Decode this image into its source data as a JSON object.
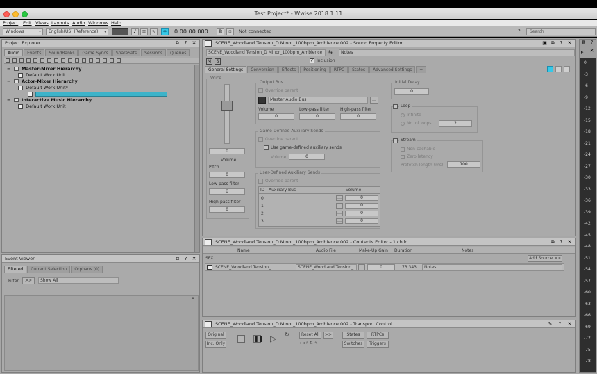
{
  "window": {
    "title": "Test Project* - Wwise 2018.1.11"
  },
  "menu": [
    "Project",
    "Edit",
    "Views",
    "Layouts",
    "Audio",
    "Windows",
    "Help"
  ],
  "toolbar": {
    "layout_value": "Windows",
    "language_value": "English(US) (Reference)",
    "timecode": "0:00:00.000",
    "connection_status": "Not connected",
    "help_glyph": "?",
    "search_placeholder": "Search"
  },
  "project_explorer": {
    "title": "Project Explorer",
    "tabs": [
      "Audio",
      "Events",
      "SoundBanks",
      "Game Syncs",
      "ShareSets",
      "Sessions",
      "Queries"
    ],
    "tree": [
      {
        "label": "Master-Mixer Hierarchy",
        "bold": true,
        "indent": 0
      },
      {
        "label": "Default Work Unit",
        "bold": false,
        "indent": 1
      },
      {
        "label": "Actor-Mixer Hierarchy",
        "bold": true,
        "indent": 0
      },
      {
        "label": "Default Work Unit*",
        "bold": false,
        "indent": 1
      },
      {
        "label": "Interactive Music Hierarchy",
        "bold": true,
        "indent": 0
      },
      {
        "label": "Default Work Unit",
        "bold": false,
        "indent": 1
      }
    ]
  },
  "event_viewer": {
    "title": "Event Viewer",
    "tabs": [
      "Filtered",
      "Current Selection",
      "Orphans (0)"
    ],
    "filter_label": "Filter",
    "filter_value": "Show All"
  },
  "sound_editor": {
    "title": "SCENE_Woodland Tension_D Minor_100bpm_Ambience 002 - Sound Property Editor",
    "object_name": "SCENE_Woodland Tension_D Minor_100bpm_Ambience",
    "notes_label": "Notes",
    "inclusion_label": "Inclusion",
    "tabs": [
      "General Settings",
      "Conversion",
      "Effects",
      "Positioning",
      "RTPC",
      "States",
      "Advanced Settings",
      "+"
    ],
    "voice": {
      "group": "Voice",
      "volume_value": "0",
      "volume_label": "Volume",
      "pitch_label": "Pitch",
      "pitch_value": "0",
      "lpf_label": "Low-pass filter",
      "lpf_value": "0",
      "hpf_label": "High-pass filter",
      "hpf_value": "0"
    },
    "output_bus": {
      "group": "Output Bus",
      "override_parent": "Override parent",
      "bus_name": "Master Audio Bus",
      "volume_label": "Volume",
      "volume_value": "0",
      "lpf_label": "Low-pass filter",
      "lpf_value": "0",
      "hpf_label": "High-pass filter",
      "hpf_value": "0"
    },
    "game_defined": {
      "group": "Game-Defined Auxiliary Sends",
      "override_parent": "Override parent",
      "use_label": "Use game-defined auxiliary sends",
      "volume_label": "Volume",
      "volume_value": "0"
    },
    "user_defined": {
      "group": "User-Defined Auxiliary Sends",
      "override_parent": "Override parent",
      "col_id": "ID",
      "col_bus": "Auxiliary Bus",
      "col_volume": "Volume",
      "rows": [
        {
          "id": "0",
          "value": "0"
        },
        {
          "id": "1",
          "value": "0"
        },
        {
          "id": "2",
          "value": "0"
        },
        {
          "id": "3",
          "value": "0"
        }
      ]
    },
    "initial_delay": {
      "group": "Initial Delay",
      "value": "0"
    },
    "loop": {
      "label": "Loop",
      "infinite": "Infinite",
      "no_of_loops": "No. of loops",
      "count": "2"
    },
    "stream": {
      "label": "Stream",
      "non_cachable": "Non-cachable",
      "zero_latency": "Zero latency",
      "prefetch_label": "Prefetch length (ms):",
      "prefetch_value": "100"
    }
  },
  "contents_editor": {
    "title": "SCENE_Woodland Tension_D Minor_100bpm_Ambience 002 - Contents Editor - 1 child",
    "columns": [
      "Name",
      "Audio File",
      "Make-Up Gain",
      "Duration",
      "Notes"
    ],
    "sfx_label": "SFX",
    "add_source": "Add Source >>",
    "row": {
      "name": "SCENE_Woodland Tension_",
      "file": "SCENE_Woodland Tension_",
      "gain": "0",
      "duration": "73.343",
      "notes": "Notes"
    }
  },
  "transport": {
    "title": "SCENE_Woodland Tension_D Minor_100bpm_Ambience 002 - Transport Control",
    "original": "Original",
    "inc_only": "Inc. Only",
    "reset_all": "Reset All",
    "more": ">>",
    "states": "States",
    "rtpcs": "RTPCs",
    "switches": "Switches",
    "triggers": "Triggers"
  },
  "meter": {
    "ticks": [
      "0",
      "-3",
      "-6",
      "-9",
      "-12",
      "-15",
      "-18",
      "-21",
      "-24",
      "-27",
      "-30",
      "-33",
      "-36",
      "-39",
      "-42",
      "-45",
      "-48",
      "-51",
      "-54",
      "-57",
      "-60",
      "-63",
      "-66",
      "-69",
      "-72",
      "-75",
      "-78"
    ]
  },
  "colors": {
    "accent": "#35c9e8",
    "selection": "#3db3c9"
  }
}
